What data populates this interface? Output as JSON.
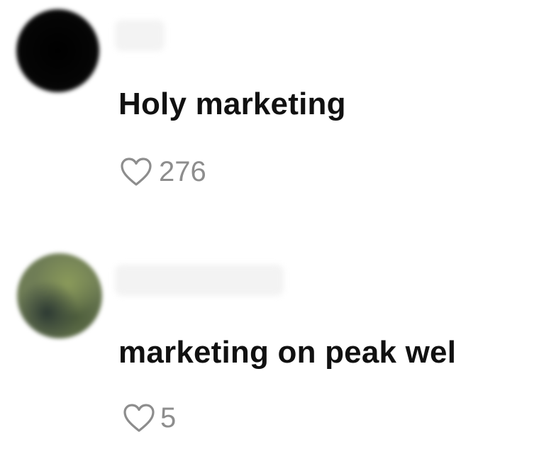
{
  "comments": [
    {
      "username": "",
      "text": "Holy marketing",
      "likes": "276",
      "avatar_color": "#000000"
    },
    {
      "username": "",
      "text": "marketing on peak wel",
      "likes": "5",
      "avatar_color": "#6f7d56"
    }
  ],
  "icons": {
    "like": "heart-outline-icon"
  },
  "colors": {
    "text": "#111111",
    "muted": "#8d8d8d",
    "background": "#ffffff"
  }
}
